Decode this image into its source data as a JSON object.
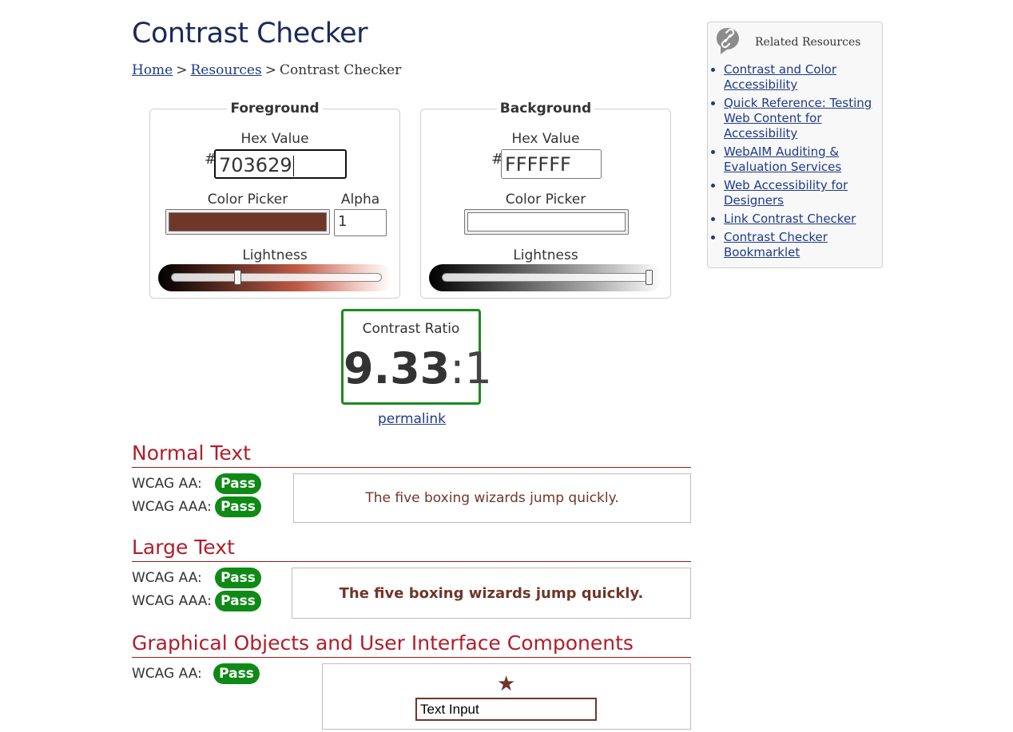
{
  "page": {
    "title": "Contrast Checker"
  },
  "breadcrumb": {
    "home": "Home",
    "separator": ">",
    "resources": "Resources",
    "current": "Contrast Checker"
  },
  "foreground": {
    "legend": "Foreground",
    "hex_label": "Hex Value",
    "hash": "#",
    "hex_value": "703629",
    "picker_label": "Color Picker",
    "alpha_label": "Alpha",
    "alpha_value": "1",
    "lightness_label": "Lightness",
    "lightness_level": 0.31,
    "color": "#703629"
  },
  "background": {
    "legend": "Background",
    "hex_label": "Hex Value",
    "hash": "#",
    "hex_value": "FFFFFF",
    "picker_label": "Color Picker",
    "lightness_label": "Lightness",
    "lightness_level": 1.0,
    "color": "#FFFFFF"
  },
  "ratio": {
    "label": "Contrast Ratio",
    "value": "9.33",
    "separator": ":",
    "denominator": "1",
    "permalink": "permalink",
    "border_color": "#1e8a1e"
  },
  "normal_text": {
    "heading": "Normal Text",
    "aa_label": "WCAG AA:",
    "aa_result": "Pass",
    "aaa_label": "WCAG AAA:",
    "aaa_result": "Pass",
    "sample": "The five boxing wizards jump quickly."
  },
  "large_text": {
    "heading": "Large Text",
    "aa_label": "WCAG AA:",
    "aa_result": "Pass",
    "aaa_label": "WCAG AAA:",
    "aaa_result": "Pass",
    "sample": "The five boxing wizards jump quickly."
  },
  "graphical": {
    "heading": "Graphical Objects and User Interface Components",
    "aa_label": "WCAG AA:",
    "aa_result": "Pass",
    "star_icon": "star-icon",
    "text_input_value": "Text Input"
  },
  "sidebar": {
    "title": "Related Resources",
    "icon": "link-icon",
    "links": [
      "Contrast and Color Accessibility",
      "Quick Reference: Testing Web Content for Accessibility",
      "WebAIM Auditing & Evaluation Services",
      "Web Accessibility for Designers",
      "Link Contrast Checker",
      "Contrast Checker Bookmarklet"
    ]
  },
  "colors": {
    "title": "#1b2a5e",
    "heading_red": "#b11d29",
    "pass_green": "#0f8a16",
    "link_blue": "#1f3a8a"
  }
}
